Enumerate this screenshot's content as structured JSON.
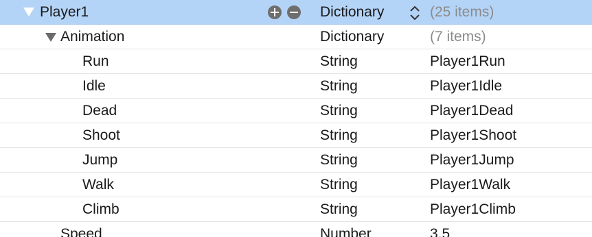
{
  "rows": [
    {
      "key": "Player1",
      "type": "Dictionary",
      "value": "(25 items)"
    },
    {
      "key": "Animation",
      "type": "Dictionary",
      "value": "(7 items)"
    },
    {
      "key": "Run",
      "type": "String",
      "value": "Player1Run"
    },
    {
      "key": "Idle",
      "type": "String",
      "value": "Player1Idle"
    },
    {
      "key": "Dead",
      "type": "String",
      "value": "Player1Dead"
    },
    {
      "key": "Shoot",
      "type": "String",
      "value": "Player1Shoot"
    },
    {
      "key": "Jump",
      "type": "String",
      "value": "Player1Jump"
    },
    {
      "key": "Walk",
      "type": "String",
      "value": "Player1Walk"
    },
    {
      "key": "Climb",
      "type": "String",
      "value": "Player1Climb"
    },
    {
      "key": "Speed",
      "type": "Number",
      "value": "3.5"
    }
  ],
  "colors": {
    "selection": "#b4d4f7",
    "disclosure_selected": "#ffffff",
    "disclosure": "#6b6b6b",
    "muted_value": "#8b8b8b"
  },
  "icons": {
    "row_0_toggle": "disclosure-triangle-expanded",
    "row_1_toggle": "disclosure-triangle-expanded",
    "add": "plus-circle-icon",
    "remove": "minus-circle-icon",
    "type_popup": "up-down-chevron-icon"
  }
}
